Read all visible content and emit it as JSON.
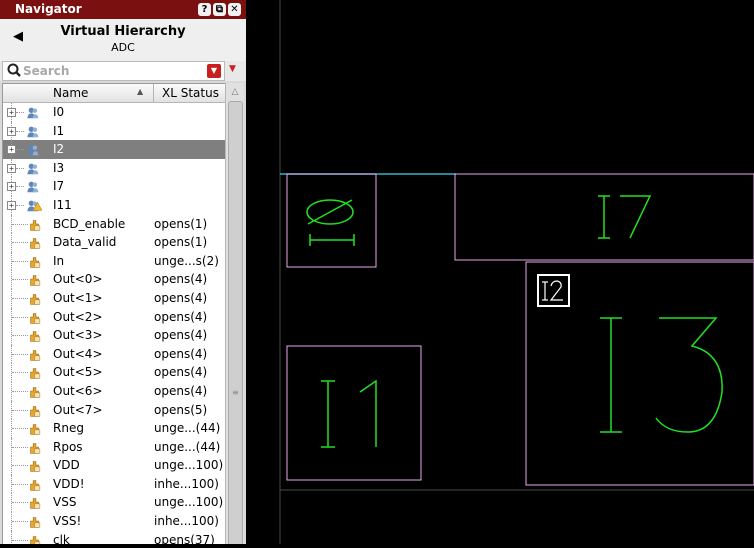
{
  "navigator": {
    "title": "Navigator",
    "title_buttons": [
      "?",
      "⧉",
      "✕"
    ],
    "header_title": "Virtual Hierarchy",
    "header_subtitle": "ADC",
    "search_placeholder": "Search",
    "columns": {
      "name": "Name",
      "status": "XL Status"
    },
    "rows": [
      {
        "name": "I0",
        "status": "",
        "kind": "instance",
        "selected": false
      },
      {
        "name": "I1",
        "status": "",
        "kind": "instance",
        "selected": false
      },
      {
        "name": "I2",
        "status": "",
        "kind": "instance",
        "selected": true
      },
      {
        "name": "I3",
        "status": "",
        "kind": "instance",
        "selected": false
      },
      {
        "name": "I7",
        "status": "",
        "kind": "instance",
        "selected": false
      },
      {
        "name": "I11",
        "status": "",
        "kind": "instance-warn",
        "selected": false
      },
      {
        "name": "BCD_enable",
        "status": "opens(1)",
        "kind": "net",
        "selected": false
      },
      {
        "name": "Data_valid",
        "status": "opens(1)",
        "kind": "net",
        "selected": false
      },
      {
        "name": "In",
        "status": "unge...s(2)",
        "kind": "net",
        "selected": false
      },
      {
        "name": "Out<0>",
        "status": "opens(4)",
        "kind": "net",
        "selected": false
      },
      {
        "name": "Out<1>",
        "status": "opens(4)",
        "kind": "net",
        "selected": false
      },
      {
        "name": "Out<2>",
        "status": "opens(4)",
        "kind": "net",
        "selected": false
      },
      {
        "name": "Out<3>",
        "status": "opens(4)",
        "kind": "net",
        "selected": false
      },
      {
        "name": "Out<4>",
        "status": "opens(4)",
        "kind": "net",
        "selected": false
      },
      {
        "name": "Out<5>",
        "status": "opens(4)",
        "kind": "net",
        "selected": false
      },
      {
        "name": "Out<6>",
        "status": "opens(4)",
        "kind": "net",
        "selected": false
      },
      {
        "name": "Out<7>",
        "status": "opens(5)",
        "kind": "net",
        "selected": false
      },
      {
        "name": "Rneg",
        "status": "unge...(44)",
        "kind": "net",
        "selected": false
      },
      {
        "name": "Rpos",
        "status": "unge...(44)",
        "kind": "net",
        "selected": false
      },
      {
        "name": "VDD",
        "status": "unge...100)",
        "kind": "net",
        "selected": false
      },
      {
        "name": "VDD!",
        "status": "inhe...100)",
        "kind": "net",
        "selected": false
      },
      {
        "name": "VSS",
        "status": "unge...100)",
        "kind": "net",
        "selected": false
      },
      {
        "name": "VSS!",
        "status": "inhe...100)",
        "kind": "net",
        "selected": false
      },
      {
        "name": "clk",
        "status": "opens(37)",
        "kind": "net",
        "selected": false
      }
    ]
  },
  "canvas": {
    "instance_labels": [
      "I0",
      "I7",
      "I2",
      "I3",
      "I1"
    ],
    "colors": {
      "background": "#000000",
      "boundary": "#e8a8e8",
      "label": "#22e022",
      "highlight": "#ffffff",
      "wire": "#33b5c8",
      "guide": "#4a4a4a"
    }
  }
}
